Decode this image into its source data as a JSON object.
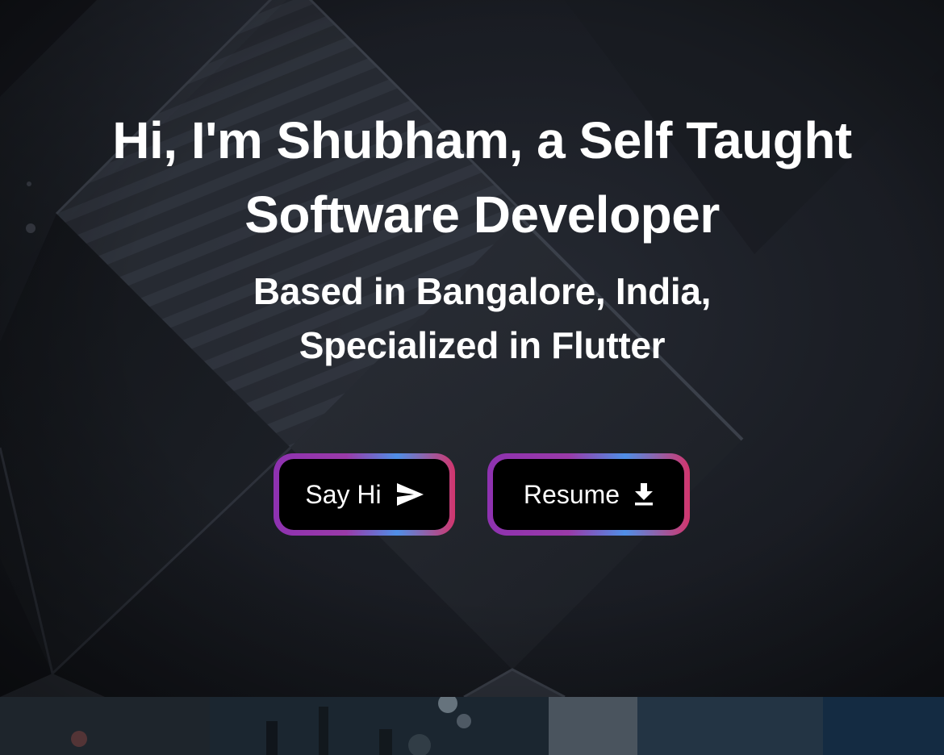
{
  "hero": {
    "headline_line1": "Hi, I'm Shubham, a Self Taught",
    "headline_line2": "Software Developer",
    "subline_line1": "Based in Bangalore, India,",
    "subline_line2": "Specialized in Flutter"
  },
  "buttons": {
    "say_hi": {
      "label": "Say Hi",
      "icon": "send-icon"
    },
    "resume": {
      "label": "Resume",
      "icon": "download-icon"
    }
  },
  "colors": {
    "background": "#15181e",
    "text": "#ffffff",
    "button_fill": "#000000",
    "border_gradient": [
      "#8e32b0",
      "#4f8fe6",
      "#d2356d"
    ]
  }
}
